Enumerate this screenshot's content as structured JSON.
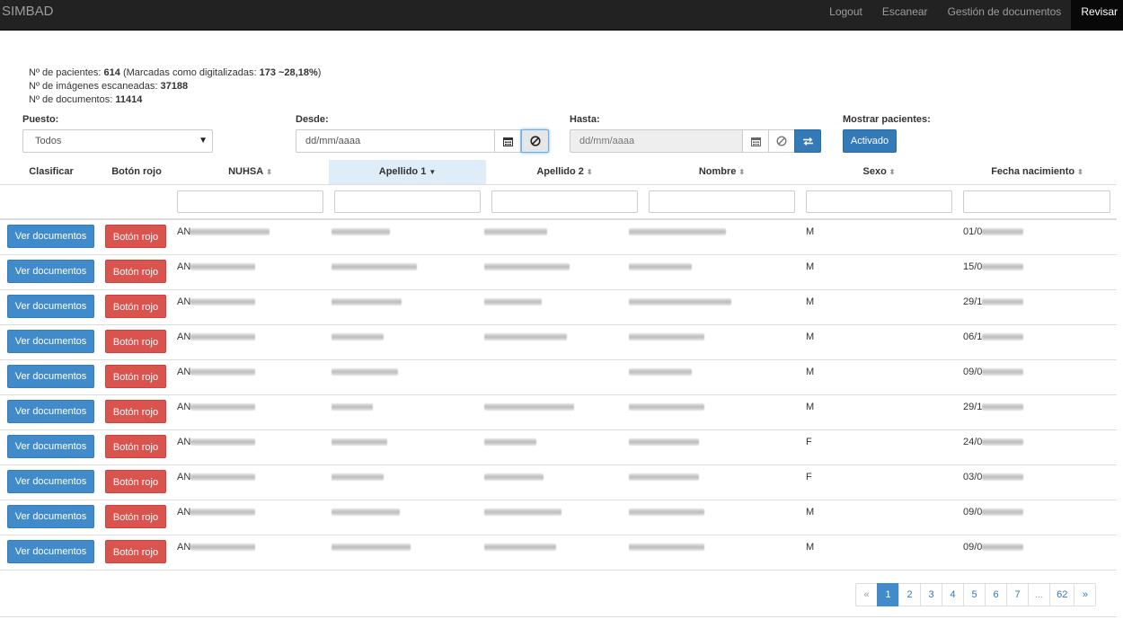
{
  "navbar": {
    "brand": "SIMBAD",
    "links": [
      "Logout",
      "Escanear",
      "Gestión de documentos",
      "Revisar"
    ]
  },
  "stats": {
    "patients_label": "Nº de pacientes:",
    "patients_value": "614",
    "marked_label": "(Marcadas como digitalizadas:",
    "marked_value": "173 ~28,18%",
    "marked_close": ")",
    "images_label": "Nº de imágenes escaneadas:",
    "images_value": "37188",
    "docs_label": "Nº de documentos:",
    "docs_value": "11414"
  },
  "filters": {
    "puesto_label": "Puesto:",
    "puesto_value": "Todos",
    "desde_label": "Desde:",
    "desde_placeholder": "dd/mm/aaaa",
    "hasta_label": "Hasta:",
    "hasta_placeholder": "dd/mm/aaaa",
    "mostrar_label": "Mostrar pacientes:",
    "mostrar_button": "Activado"
  },
  "table": {
    "headers": [
      "Clasificar",
      "Botón rojo",
      "NUHSA",
      "Apellido 1",
      "Apellido 2",
      "Nombre",
      "Sexo",
      "Fecha nacimiento"
    ],
    "sort_neutral": "⬍",
    "sort_active": "▼",
    "view_button": "Ver documentos",
    "red_button": "Botón rojo",
    "rows": [
      {
        "nuhsa": "AN",
        "sexo": "M",
        "fecha": "01/0"
      },
      {
        "nuhsa": "AN",
        "sexo": "M",
        "fecha": "15/0"
      },
      {
        "nuhsa": "AN",
        "sexo": "M",
        "fecha": "29/1"
      },
      {
        "nuhsa": "AN",
        "sexo": "M",
        "fecha": "06/1"
      },
      {
        "nuhsa": "AN",
        "sexo": "M",
        "fecha": "09/0"
      },
      {
        "nuhsa": "AN",
        "sexo": "M",
        "fecha": "29/1"
      },
      {
        "nuhsa": "AN",
        "sexo": "F",
        "fecha": "24/0"
      },
      {
        "nuhsa": "AN",
        "sexo": "F",
        "fecha": "03/0"
      },
      {
        "nuhsa": "AN",
        "sexo": "M",
        "fecha": "09/0"
      },
      {
        "nuhsa": "AN",
        "sexo": "M",
        "fecha": "09/0"
      }
    ]
  },
  "pagination": [
    "«",
    "1",
    "2",
    "3",
    "4",
    "5",
    "6",
    "7",
    "...",
    "62",
    "»"
  ],
  "colors": {
    "navbar": "#222222",
    "primary": "#428bca",
    "danger": "#d9534f",
    "sorted_header": "#deedf7"
  }
}
